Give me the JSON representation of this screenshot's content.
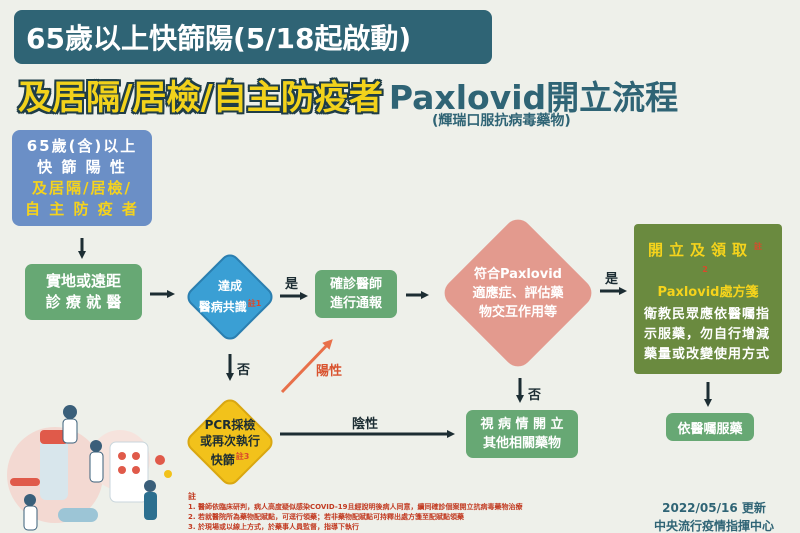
{
  "title": {
    "line1": "65歲以上快篩陽(5/18起啟動)",
    "line2_highlight": "及居隔/居檢/自主防疫者",
    "line2_rest": "Paxlovid開立流程",
    "drug_note": "(輝瑞口服抗病毒藥物)"
  },
  "nodes": {
    "eligible": {
      "line1": "65歲(含)以上",
      "line2": "快 篩 陽 性",
      "line3": "及居隔/居檢/",
      "line4": "自 主 防 疫 者"
    },
    "consult": {
      "line1": "實地或遠距",
      "line2": "診 療 就 醫"
    },
    "consensus": {
      "line1": "達成",
      "line2": "醫病共識",
      "note": "註1"
    },
    "report": {
      "line1": "確診醫師",
      "line2": "進行通報"
    },
    "paxlovid_check": {
      "line1": "符合Paxlovid",
      "line2": "適應症、評估藥",
      "line3": "物交互作用等"
    },
    "prescribe": {
      "header1": "開立及領取",
      "header2": "Paxlovid處方箋",
      "note": "註2",
      "body": "衛教民眾應依醫囑指示服藥，勿自行增減藥量或改變使用方式"
    },
    "pcr": {
      "line1": "PCR採檢",
      "line2": "或再次執行",
      "line3": "快篩",
      "note": "註3"
    },
    "alt_drug": {
      "line1": "視 病 情 開 立",
      "line2": "其他相關藥物"
    },
    "take_med": {
      "label": "依醫囑服藥"
    }
  },
  "edge_labels": {
    "yes1": "是",
    "yes2": "是",
    "no1": "否",
    "no2": "否",
    "positive": "陽性",
    "negative": "陰性"
  },
  "footnotes": {
    "title": "註",
    "n1": "1. 醫師依臨床研判，病人高度疑似感染COVID-19且經說明後病人同意，續同確診個案開立抗病毒藥物治療",
    "n2": "2. 若就醫院所為藥物配賦點，可逕行領藥；若非藥物配賦點可持釋出處方箋至配賦點領藥",
    "n3": "3. 於現場或以線上方式，於藥事人員監督，指導下執行"
  },
  "date": "2022/05/16 更新",
  "credit": "中央流行疫情指揮中心",
  "colors": {
    "title_bg": "#2f6475",
    "highlight_yellow": "#f2d21b",
    "blue_box": "#6b8fc6",
    "green_box": "#67a874",
    "dark_green_box": "#6a8a3f",
    "consensus_diamond": "#3a9fd4",
    "pcr_diamond": "#f2c21b",
    "paxlovid_diamond": "#e39a8e",
    "positive_arrow": "#e8704a",
    "background": "#eef0ea"
  }
}
